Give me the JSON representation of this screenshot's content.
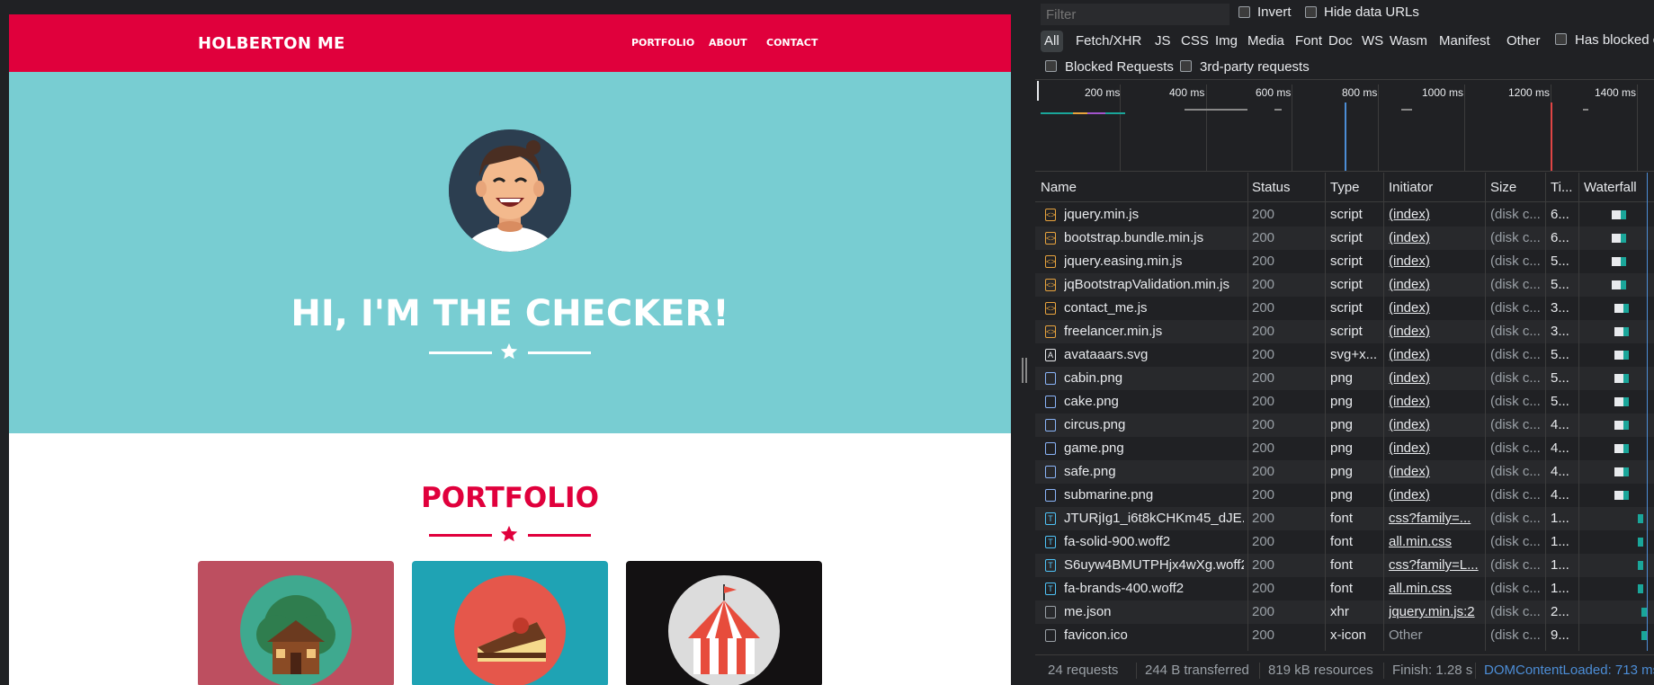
{
  "site": {
    "brand": "HOLBERTON ME",
    "nav": [
      "PORTFOLIO",
      "ABOUT",
      "CONTACT"
    ],
    "hero_title": "HI, I'M THE CHECKER!",
    "portfolio_title": "PORTFOLIO",
    "colors": {
      "primary": "#e0003c",
      "hero_bg": "#78cdd2"
    },
    "cards": [
      {
        "name": "cabin",
        "bg": "#bd4f60",
        "circle": "#3fa98f"
      },
      {
        "name": "cake",
        "bg": "#1fa3b4",
        "circle": "#e5574b"
      },
      {
        "name": "circus",
        "bg": "#131112",
        "circle": "#dcdcdc"
      }
    ]
  },
  "devtools": {
    "filter_placeholder": "Filter",
    "invert_label": "Invert",
    "hide_data_urls_label": "Hide data URLs",
    "type_filters": [
      "All",
      "Fetch/XHR",
      "JS",
      "CSS",
      "Img",
      "Media",
      "Font",
      "Doc",
      "WS",
      "Wasm",
      "Manifest",
      "Other"
    ],
    "has_blocked_label": "Has blocked c",
    "blocked_requests_label": "Blocked Requests",
    "third_party_label": "3rd-party requests",
    "timeline_labels": [
      "200 ms",
      "400 ms",
      "600 ms",
      "800 ms",
      "1000 ms",
      "1200 ms",
      "1400 ms"
    ],
    "columns": [
      "Name",
      "Status",
      "Type",
      "Initiator",
      "Size",
      "Ti...",
      "Waterfall"
    ],
    "rows": [
      {
        "icon": "script-icon",
        "name": "jquery.min.js",
        "status": "200",
        "type": "script",
        "initiator": "(index)",
        "size": "(disk c...",
        "time": "6..."
      },
      {
        "icon": "script-icon",
        "name": "bootstrap.bundle.min.js",
        "status": "200",
        "type": "script",
        "initiator": "(index)",
        "size": "(disk c...",
        "time": "6..."
      },
      {
        "icon": "script-icon",
        "name": "jquery.easing.min.js",
        "status": "200",
        "type": "script",
        "initiator": "(index)",
        "size": "(disk c...",
        "time": "5..."
      },
      {
        "icon": "script-icon",
        "name": "jqBootstrapValidation.min.js",
        "status": "200",
        "type": "script",
        "initiator": "(index)",
        "size": "(disk c...",
        "time": "5..."
      },
      {
        "icon": "script-icon",
        "name": "contact_me.js",
        "status": "200",
        "type": "script",
        "initiator": "(index)",
        "size": "(disk c...",
        "time": "3..."
      },
      {
        "icon": "script-icon",
        "name": "freelancer.min.js",
        "status": "200",
        "type": "script",
        "initiator": "(index)",
        "size": "(disk c...",
        "time": "3..."
      },
      {
        "icon": "svg-icon",
        "name": "avataaars.svg",
        "status": "200",
        "type": "svg+x...",
        "initiator": "(index)",
        "size": "(disk c...",
        "time": "5..."
      },
      {
        "icon": "image-icon",
        "name": "cabin.png",
        "status": "200",
        "type": "png",
        "initiator": "(index)",
        "size": "(disk c...",
        "time": "5..."
      },
      {
        "icon": "image-icon",
        "name": "cake.png",
        "status": "200",
        "type": "png",
        "initiator": "(index)",
        "size": "(disk c...",
        "time": "5..."
      },
      {
        "icon": "image-icon",
        "name": "circus.png",
        "status": "200",
        "type": "png",
        "initiator": "(index)",
        "size": "(disk c...",
        "time": "4..."
      },
      {
        "icon": "image-icon",
        "name": "game.png",
        "status": "200",
        "type": "png",
        "initiator": "(index)",
        "size": "(disk c...",
        "time": "4..."
      },
      {
        "icon": "image-icon",
        "name": "safe.png",
        "status": "200",
        "type": "png",
        "initiator": "(index)",
        "size": "(disk c...",
        "time": "4..."
      },
      {
        "icon": "image-icon",
        "name": "submarine.png",
        "status": "200",
        "type": "png",
        "initiator": "(index)",
        "size": "(disk c...",
        "time": "4..."
      },
      {
        "icon": "font-icon",
        "name": "JTURjIg1_i6t8kCHKm45_dJE...",
        "status": "200",
        "type": "font",
        "initiator": "css?family=...",
        "size": "(disk c...",
        "time": "1..."
      },
      {
        "icon": "font-icon",
        "name": "fa-solid-900.woff2",
        "status": "200",
        "type": "font",
        "initiator": "all.min.css",
        "size": "(disk c...",
        "time": "1..."
      },
      {
        "icon": "font-icon",
        "name": "S6uyw4BMUTPHjx4wXg.woff2",
        "status": "200",
        "type": "font",
        "initiator": "css?family=L...",
        "size": "(disk c...",
        "time": "1..."
      },
      {
        "icon": "font-icon",
        "name": "fa-brands-400.woff2",
        "status": "200",
        "type": "font",
        "initiator": "all.min.css",
        "size": "(disk c...",
        "time": "1..."
      },
      {
        "icon": "xhr-icon",
        "name": "me.json",
        "status": "200",
        "type": "xhr",
        "initiator": "jquery.min.js:2",
        "size": "(disk c...",
        "time": "2..."
      },
      {
        "icon": "other-icon",
        "name": "favicon.ico",
        "status": "200",
        "type": "x-icon",
        "initiator": "Other",
        "size": "(disk c...",
        "time": "9..."
      }
    ],
    "status_bar": {
      "requests": "24 requests",
      "transferred": "244 B transferred",
      "resources": "819 kB resources",
      "finish": "Finish: 1.28 s",
      "dom_content_loaded": "DOMContentLoaded: 713 ms"
    }
  }
}
